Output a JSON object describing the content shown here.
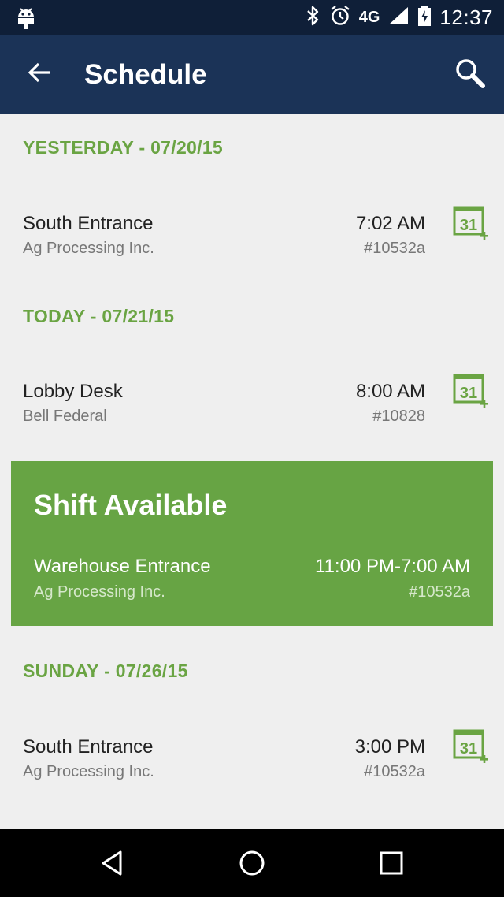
{
  "status_bar": {
    "time": "12:37",
    "network": "4G",
    "icons": [
      "android-icon",
      "bluetooth-icon",
      "alarm-icon",
      "network-4g-icon",
      "signal-icon",
      "battery-charging-icon"
    ]
  },
  "app_bar": {
    "title": "Schedule",
    "back_icon": "arrow-left-icon",
    "search_icon": "search-icon"
  },
  "colors": {
    "status_bar": "#0f1f38",
    "app_bar": "#1b3357",
    "accent_green": "#6aa443",
    "card_green": "#67a444",
    "background": "#efefef"
  },
  "sections": [
    {
      "header": "YESTERDAY - 07/20/15",
      "items": [
        {
          "site": "South Entrance",
          "company": "Ag Processing Inc.",
          "time": "7:02 AM",
          "code": "#10532a",
          "action_icon": "calendar-add-icon",
          "action_day": "31"
        }
      ]
    },
    {
      "header": "TODAY - 07/21/15",
      "items": [
        {
          "site": "Lobby Desk",
          "company": "Bell Federal",
          "time": "8:00 AM",
          "code": "#10828",
          "action_icon": "calendar-add-icon",
          "action_day": "31"
        }
      ]
    },
    {
      "header": "SUNDAY - 07/26/15",
      "items": [
        {
          "site": "South Entrance",
          "company": "Ag Processing Inc.",
          "time": "3:00 PM",
          "code": "#10532a",
          "action_icon": "calendar-add-icon",
          "action_day": "31"
        }
      ]
    }
  ],
  "shift_available": {
    "heading": "Shift Available",
    "site": "Warehouse Entrance",
    "company": "Ag Processing Inc.",
    "time": "11:00 PM-7:00 AM",
    "code": "#10532a"
  },
  "nav_bar": {
    "icons": [
      "back-triangle-icon",
      "home-circle-icon",
      "recents-square-icon"
    ]
  }
}
